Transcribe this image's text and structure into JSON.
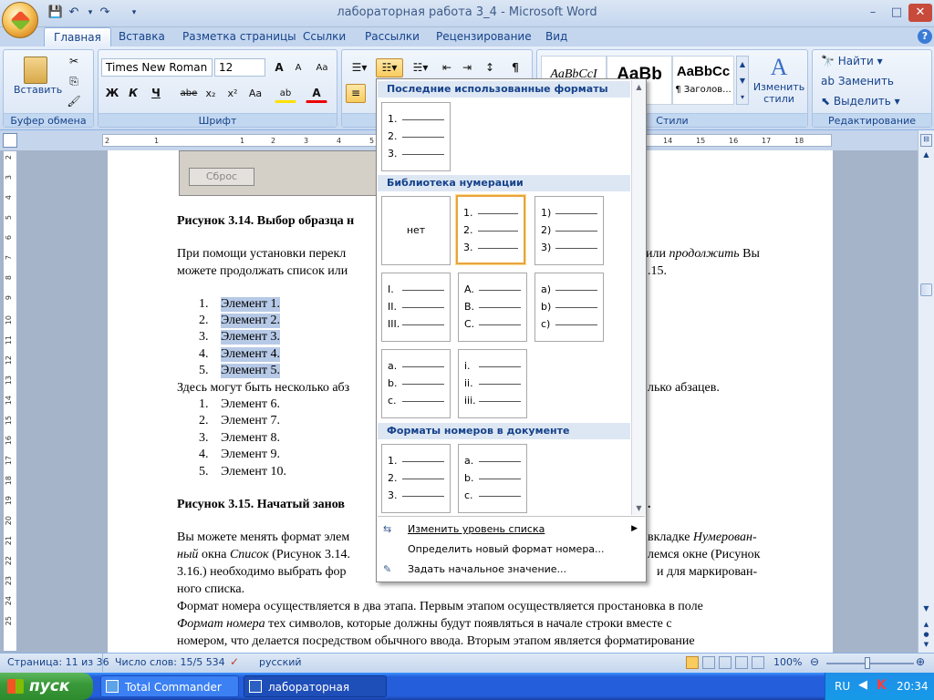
{
  "window": {
    "title": "лабораторная работа 3_4 - Microsoft Word",
    "controls": [
      "–",
      "□",
      "✕"
    ],
    "doc_controls": [
      "–",
      "□",
      "✕"
    ]
  },
  "qat": {
    "save": "💾",
    "undo": "↶",
    "redo": "↷",
    "more": "▾"
  },
  "tabs": [
    "Главная",
    "Вставка",
    "Разметка страницы",
    "Ссылки",
    "Рассылки",
    "Рецензирование",
    "Вид"
  ],
  "ribbon": {
    "clipboard": {
      "label": "Буфер обмена",
      "paste": "Вставить"
    },
    "font": {
      "label": "Шрифт",
      "name": "Times New Roman",
      "size": "12",
      "grow": "A",
      "shrink": "A",
      "clear": "Aa",
      "bold": "Ж",
      "italic": "К",
      "underline": "Ч",
      "strike": "abe",
      "sub": "x₂",
      "sup": "x²",
      "case": "Aa",
      "highlight": "ab",
      "color": "A"
    },
    "styles": {
      "label": "Стили",
      "s1": "AaBbCcI",
      "s2": "AaBb",
      "s3": "AaBbCc",
      "s3_label": "¶ Заголов...",
      "change": "Изменить",
      "change2": "стили"
    },
    "editing": {
      "label": "Редактирование",
      "find": "Найти",
      "replace": "Заменить",
      "select": "Выделить"
    }
  },
  "ruler": {
    "h": [
      "2",
      "1",
      "1",
      "2",
      "3",
      "4",
      "5",
      "6",
      "7",
      "8",
      "9",
      "10",
      "11",
      "12",
      "13",
      "14",
      "15",
      "16",
      "17",
      "18"
    ],
    "v": [
      "2",
      "3",
      "4",
      "5",
      "6",
      "7",
      "8",
      "9",
      "10",
      "11",
      "12",
      "13",
      "14",
      "15",
      "16",
      "17",
      "18",
      "19",
      "20",
      "21",
      "22",
      "23",
      "24",
      "25"
    ]
  },
  "doc": {
    "reset_btn": "Сброс",
    "fig314_bold": "Рисунок 3.14. Выбор образца н",
    "p1a": "При помощи установки перекл",
    "p1b": "или",
    "p1_ital": "продолжить",
    "p1c": "Вы",
    "p2a": "можете продолжать список или",
    "p2b": ".15.",
    "list1": [
      {
        "n": "1.",
        "t": "Элемент 1."
      },
      {
        "n": "2.",
        "t": "Элемент 2."
      },
      {
        "n": "3.",
        "t": "Элемент 3."
      },
      {
        "n": "4.",
        "t": "Элемент 4."
      },
      {
        "n": "5.",
        "t": "Элемент 5."
      }
    ],
    "mid_a": "Здесь могут быть несколько абз",
    "mid_b": "лько абзацев.",
    "list2": [
      {
        "n": "1.",
        "t": "Элемент 6."
      },
      {
        "n": "2.",
        "t": "Элемент 7."
      },
      {
        "n": "3.",
        "t": "Элемент 8."
      },
      {
        "n": "4.",
        "t": "Элемент 9."
      },
      {
        "n": "5.",
        "t": "Элемент 10."
      }
    ],
    "fig315_a": "Рисунок 3.15.  Начатый занов",
    "fig315_b": ".",
    "p3a": "Вы можете менять формат элем",
    "p3b": "вкладке",
    "p3b_i": "Нумерован-",
    "p4a_i": "ный",
    "p4b": "окна",
    "p4c_i": "Список",
    "p4d": "(Рисунок 3.14.",
    "p4e": "лемся окне (Рисунок",
    "p5a": "3.16.) необходимо выбрать фор",
    "p5b": "и для маркирован-",
    "p6": "ного списка.",
    "p7": "Формат номера осуществляется в два этапа. Первым этапом осуществляется простановка в поле",
    "p8_i": "Формат номера",
    "p8": "тех символов, которые должны будут появляться в начале строки вместе с",
    "p9": "номером, что делается посредством обычного ввода. Вторым этапом является форматирование"
  },
  "numbering_menu": {
    "recent_header": "Последние использованные форматы номеров",
    "library_header": "Библиотека нумерации",
    "doc_header": "Форматы номеров в документе",
    "none_label": "нет",
    "recent": [
      [
        "1.",
        "2.",
        "3."
      ]
    ],
    "library": [
      [
        "1.",
        "2.",
        "3."
      ],
      [
        "1)",
        "2)",
        "3)"
      ],
      [
        "I.",
        "II.",
        "III."
      ],
      [
        "A.",
        "B.",
        "C."
      ],
      [
        "a)",
        "b)",
        "c)"
      ],
      [
        "a.",
        "b.",
        "c."
      ],
      [
        "i.",
        "ii.",
        "iii."
      ]
    ],
    "document": [
      [
        "1.",
        "2.",
        "3."
      ],
      [
        "a.",
        "b.",
        "c."
      ]
    ],
    "items": [
      "Изменить уровень списка",
      "Определить новый формат номера...",
      "Задать начальное значение..."
    ]
  },
  "status": {
    "page": "Страница: 11 из 36",
    "words": "Число слов: 15/5 534",
    "lang": "русский",
    "zoom": "100%"
  },
  "taskbar": {
    "start": "пуск",
    "tasks": [
      "Total Commander 6.5...",
      "лабораторная рабо..."
    ],
    "lang": "RU",
    "time": "20:34"
  }
}
